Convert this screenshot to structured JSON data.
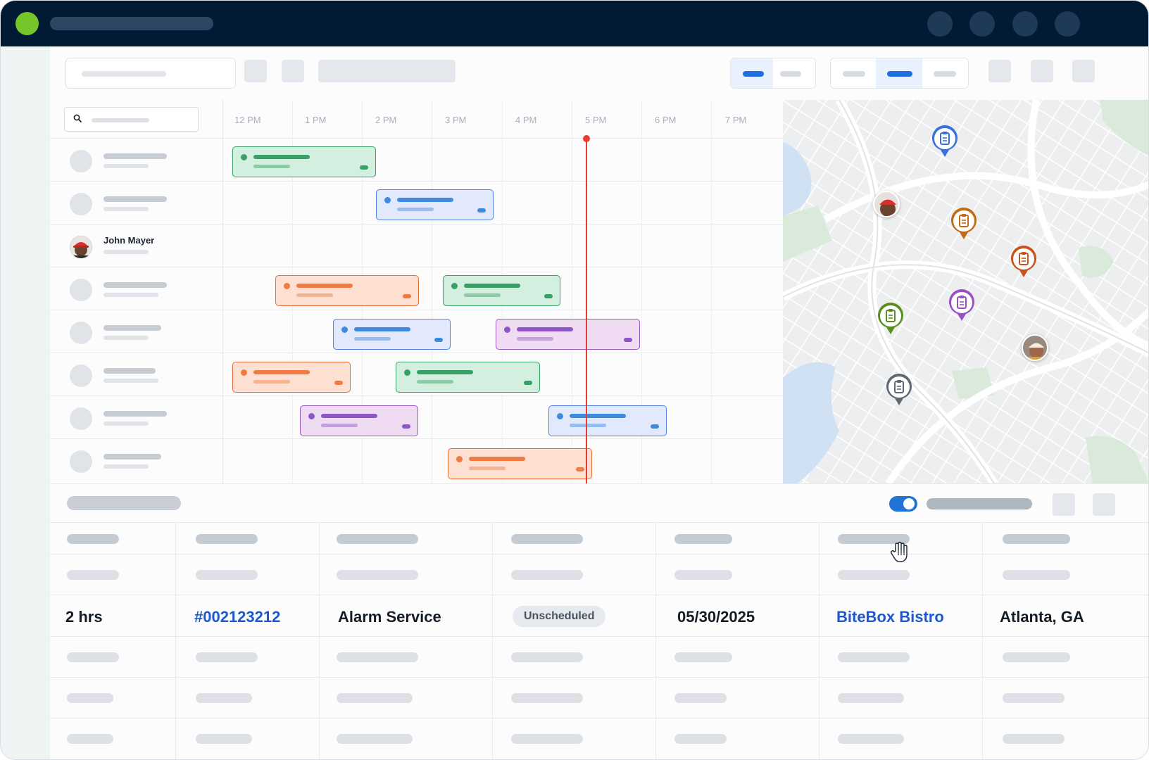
{
  "colors": {
    "topbar": "#021b35",
    "brand": "#76c52a",
    "accent": "#1f74d6",
    "now_indicator": "#e53d30",
    "link": "#1c58d0",
    "job_green": "#37a064",
    "job_blue": "#3d8ae0",
    "job_orange": "#ef7a44",
    "job_purple": "#8e56c6"
  },
  "schedule": {
    "hours": [
      "12 PM",
      "1 PM",
      "2 PM",
      "3 PM",
      "4 PM",
      "5 PM",
      "6 PM",
      "7 PM"
    ],
    "technician_highlighted": "John Mayer",
    "current_time_indicator": "5 PM"
  },
  "map": {
    "pins": [
      {
        "type": "clipboard-icon",
        "color": "#3a6fe0"
      },
      {
        "type": "clipboard-icon",
        "color": "#c26a14"
      },
      {
        "type": "clipboard-icon",
        "color": "#c8541d"
      },
      {
        "type": "clipboard-icon",
        "color": "#5a8e1e"
      },
      {
        "type": "clipboard-icon",
        "color": "#9a4fc4"
      },
      {
        "type": "clipboard-icon",
        "color": "#606874"
      }
    ]
  },
  "table": {
    "row": {
      "duration": "2 hrs",
      "job_number": "#002123212",
      "service": "Alarm Service",
      "status": "Unscheduled",
      "date": "05/30/2025",
      "customer": "BiteBox Bistro",
      "location": "Atlanta, GA"
    },
    "toggle_on": true
  }
}
